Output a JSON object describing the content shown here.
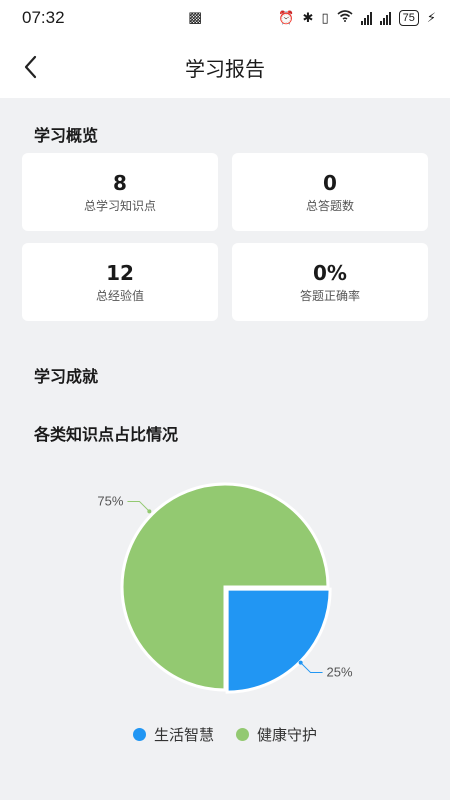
{
  "status_bar": {
    "time": "07:32",
    "battery": "75",
    "icons": [
      "nfc-icon",
      "alarm-icon",
      "bluetooth-icon",
      "vibrate-icon",
      "wifi-icon",
      "signal-icon",
      "signal-icon",
      "battery-icon",
      "charging-icon"
    ]
  },
  "header": {
    "title": "学习报告",
    "back_icon": "chevron-left-icon"
  },
  "overview": {
    "title": "学习概览",
    "cards": [
      {
        "value": "8",
        "label": "总学习知识点"
      },
      {
        "value": "0",
        "label": "总答题数"
      },
      {
        "value": "12",
        "label": "总经验值"
      },
      {
        "value": "0%",
        "label": "答题正确率"
      }
    ]
  },
  "achievements": {
    "title": "学习成就"
  },
  "distribution": {
    "title": "各类知识点占比情况"
  },
  "chart_data": {
    "type": "pie",
    "title": "各类知识点占比情况",
    "categories": [
      "生活智慧",
      "健康守护"
    ],
    "values": [
      25,
      75
    ],
    "labels": [
      "25%",
      "75%"
    ],
    "colors": [
      "#2196f3",
      "#93c971"
    ],
    "legend_position": "bottom"
  }
}
